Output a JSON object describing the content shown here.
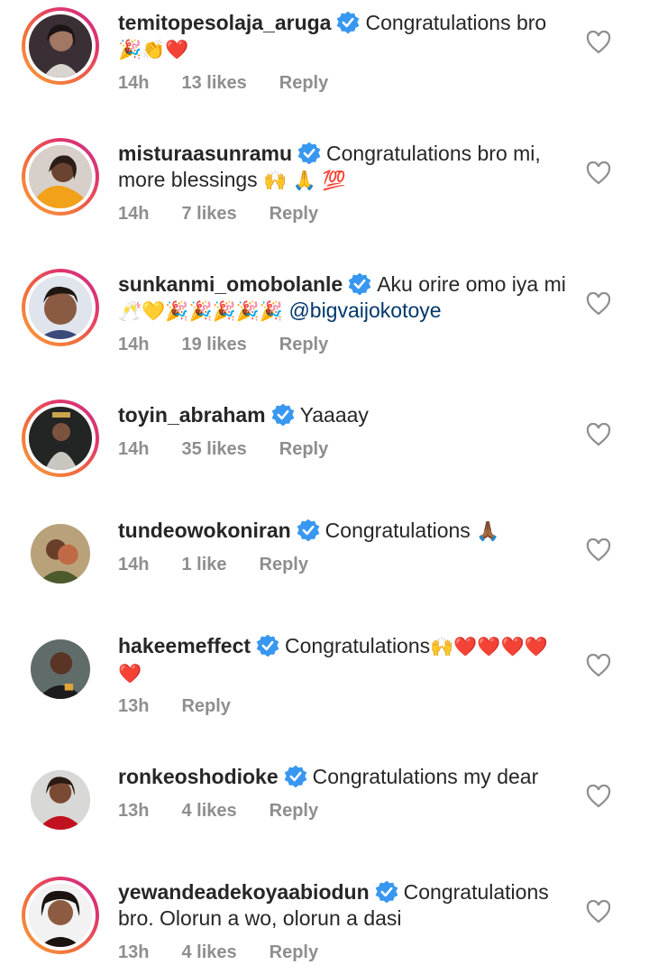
{
  "comments": [
    {
      "username": "temitopesolaja_aruga",
      "text": "Congratulations bro",
      "emoji": "🎉👏❤️",
      "time": "14h",
      "likes": "13 likes",
      "reply": "Reply"
    },
    {
      "username": "misturaasunramu",
      "text": "Congratulations bro mi, more blessings",
      "emoji": "🙌 🙏 💯",
      "time": "14h",
      "likes": "7 likes",
      "reply": "Reply"
    },
    {
      "username": "sunkanmi_omobolanle",
      "text": "Aku orire omo iya mi",
      "emoji": "🥂💛🎉🎉🎉🎉🎉",
      "mention": "@bigvaijokotoye",
      "time": "14h",
      "likes": "19 likes",
      "reply": "Reply"
    },
    {
      "username": "toyin_abraham",
      "text": "Yaaaay",
      "time": "14h",
      "likes": "35 likes",
      "reply": "Reply"
    },
    {
      "username": "tundeowokoniran",
      "text": "Congratulations",
      "emoji": "🙏🏾",
      "time": "14h",
      "likes": "1 like",
      "reply": "Reply"
    },
    {
      "username": "hakeemeffect",
      "text": "Congratulations",
      "emoji": "🙌❤️❤️❤️❤️❤️",
      "time": "13h",
      "reply": "Reply"
    },
    {
      "username": "ronkeoshodioke",
      "text": "Congratulations my dear",
      "time": "13h",
      "likes": "4 likes",
      "reply": "Reply"
    },
    {
      "username": "yewandeadekoyaabiodun",
      "text": "Congratulations bro. Olorun a wo, olorun a dasi",
      "time": "13h",
      "likes": "4 likes",
      "reply": "Reply"
    }
  ],
  "icons": {
    "verified": "verified-badge-icon",
    "like": "heart-outline-icon"
  },
  "colors": {
    "verified": "#3897f0",
    "meta": "#8e8e8e",
    "mention": "#00376b"
  }
}
